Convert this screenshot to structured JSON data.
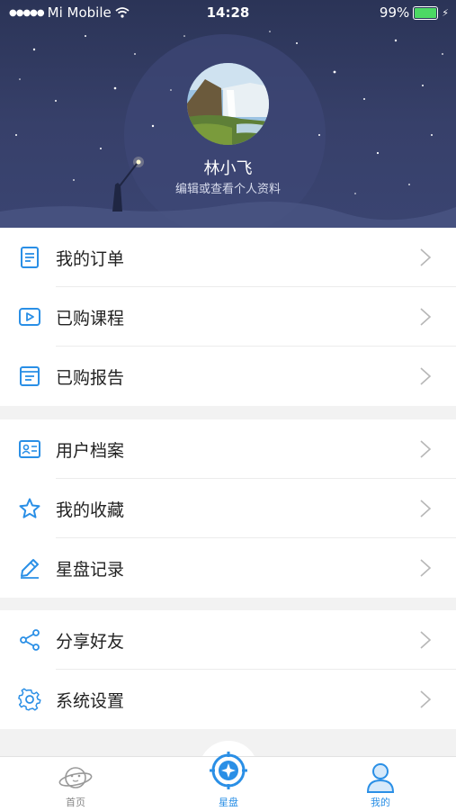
{
  "status_bar": {
    "carrier": "Mi Mobile",
    "time": "14:28",
    "battery": "99%"
  },
  "profile": {
    "name": "林小飞",
    "subtitle": "编辑或查看个人资料"
  },
  "menu_groups": [
    [
      {
        "label": "我的订单",
        "icon": "order-document-icon"
      },
      {
        "label": "已购课程",
        "icon": "course-play-icon"
      },
      {
        "label": "已购报告",
        "icon": "report-icon"
      }
    ],
    [
      {
        "label": "用户档案",
        "icon": "profile-card-icon"
      },
      {
        "label": "我的收藏",
        "icon": "star-icon"
      },
      {
        "label": "星盘记录",
        "icon": "pencil-icon"
      }
    ],
    [
      {
        "label": "分享好友",
        "icon": "share-icon"
      },
      {
        "label": "系统设置",
        "icon": "gear-icon"
      }
    ]
  ],
  "tab_bar": {
    "tabs": [
      {
        "label": "首页",
        "icon": "planet-icon",
        "active": false
      },
      {
        "label": "星盘",
        "icon": "astrolabe-icon",
        "active": true
      },
      {
        "label": "我的",
        "icon": "person-icon",
        "active": true
      }
    ]
  },
  "colors": {
    "accent": "#2a8fe6",
    "header_bg": "#333c63",
    "text": "#222222",
    "inactive": "#888888"
  }
}
